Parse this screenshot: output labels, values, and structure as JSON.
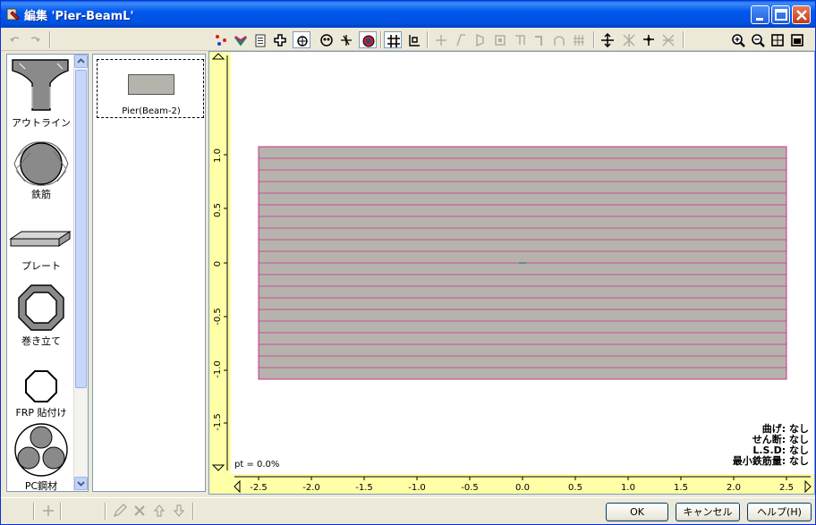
{
  "window": {
    "title": "編集 'Pier-BeamL'"
  },
  "toolbar": {
    "undo_icon": "undo-icon",
    "redo_icon": "redo-icon"
  },
  "palette": {
    "items": [
      {
        "label": "アウトライン",
        "icon": "outline-icon"
      },
      {
        "label": "鉄筋",
        "icon": "rebar-icon"
      },
      {
        "label": "プレート",
        "icon": "plate-icon"
      },
      {
        "label": "巻き立て",
        "icon": "jacketing-icon"
      },
      {
        "label": "FRP 貼付け",
        "icon": "frp-icon"
      },
      {
        "label": "PC鋼材",
        "icon": "pc-steel-icon"
      }
    ]
  },
  "sections": {
    "items": [
      {
        "label": "Pier(Beam-2)"
      }
    ]
  },
  "canvas": {
    "pt_label": "pt = 0.0%",
    "info": [
      "曲げ: なし",
      "せん断: なし",
      "L.S.D: なし",
      "最小鉄筋量: なし"
    ],
    "y_ticks": [
      "1.0",
      "0.5",
      "0",
      "-0.5",
      "-1.0",
      "-1.5"
    ],
    "x_ticks": [
      "-2.5",
      "-2.0",
      "-1.5",
      "-1.0",
      "-0.5",
      "0.0",
      "0.5",
      "1.0",
      "1.5",
      "2.0",
      "2.5"
    ]
  },
  "buttons": {
    "ok": "OK",
    "cancel": "キャンセル",
    "help": "ヘルプ(H)"
  },
  "colors": {
    "section_fill": "#b6b3ad",
    "rebar_line": "#c8308a",
    "ruler_bg": "#ffffa8",
    "titlebar": "#0058ee"
  }
}
